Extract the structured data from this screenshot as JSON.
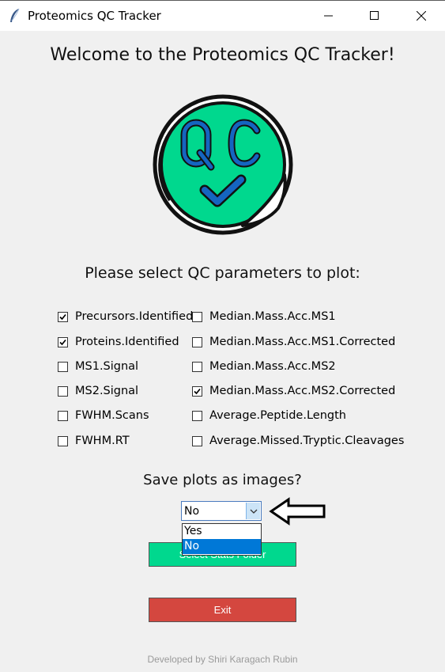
{
  "window": {
    "title": "Proteomics QC Tracker",
    "controls": [
      "minimize-icon",
      "maximize-icon",
      "close-icon"
    ]
  },
  "heading": "Welcome to the Proteomics QC Tracker!",
  "logo": {
    "text": "QC",
    "colors": {
      "fill": "#00d88e",
      "text": "#1565c0",
      "outline": "#111111"
    }
  },
  "parameters_prompt": "Please select QC parameters to plot:",
  "parameters": {
    "left": [
      {
        "label": "Precursors.Identified",
        "checked": true
      },
      {
        "label": "Proteins.Identified",
        "checked": true
      },
      {
        "label": "MS1.Signal",
        "checked": false
      },
      {
        "label": "MS2.Signal",
        "checked": false
      },
      {
        "label": "FWHM.Scans",
        "checked": false
      },
      {
        "label": "FWHM.RT",
        "checked": false
      }
    ],
    "right": [
      {
        "label": "Median.Mass.Acc.MS1",
        "checked": false
      },
      {
        "label": "Median.Mass.Acc.MS1.Corrected",
        "checked": false
      },
      {
        "label": "Median.Mass.Acc.MS2",
        "checked": false
      },
      {
        "label": "Median.Mass.Acc.MS2.Corrected",
        "checked": true
      },
      {
        "label": "Average.Peptide.Length",
        "checked": false
      },
      {
        "label": "Average.Missed.Tryptic.Cleavages",
        "checked": false
      }
    ]
  },
  "save_prompt": "Save plots as images?",
  "save_select": {
    "value": "No",
    "options": [
      "Yes",
      "No"
    ],
    "highlighted": "No"
  },
  "buttons": {
    "select_folder": "Select Stats Folder",
    "exit": "Exit"
  },
  "colors": {
    "green_button": "#00d88e",
    "red_button": "#d4473f",
    "selection": "#0078d7"
  },
  "footer": "Developed by Shiri Karagach Rubin"
}
